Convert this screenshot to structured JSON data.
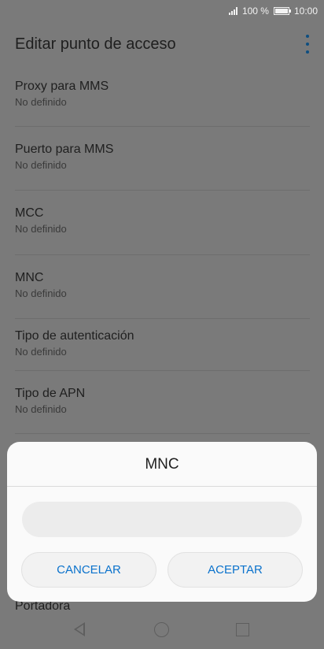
{
  "status_bar": {
    "battery_text": "100 %",
    "time": "10:00"
  },
  "header": {
    "title": "Editar punto de acceso"
  },
  "settings": [
    {
      "label": "Proxy para MMS",
      "value": "No definido"
    },
    {
      "label": "Puerto para MMS",
      "value": "No definido"
    },
    {
      "label": "MCC",
      "value": "No definido"
    },
    {
      "label": "MNC",
      "value": "No definido"
    },
    {
      "label": "Tipo de autenticación",
      "value": "No definido"
    },
    {
      "label": "Tipo de APN",
      "value": "No definido"
    }
  ],
  "partial_item_label": "Portadora",
  "dialog": {
    "title": "MNC",
    "input_value": "",
    "input_placeholder": "",
    "cancel_label": "CANCELAR",
    "accept_label": "ACEPTAR"
  },
  "colors": {
    "accent": "#0a72cc",
    "overflow_icon": "#0e4e80"
  },
  "icons": [
    "signal-icon",
    "battery-icon",
    "more-options-icon",
    "nav-back-icon",
    "nav-home-icon",
    "nav-recent-icon"
  ]
}
